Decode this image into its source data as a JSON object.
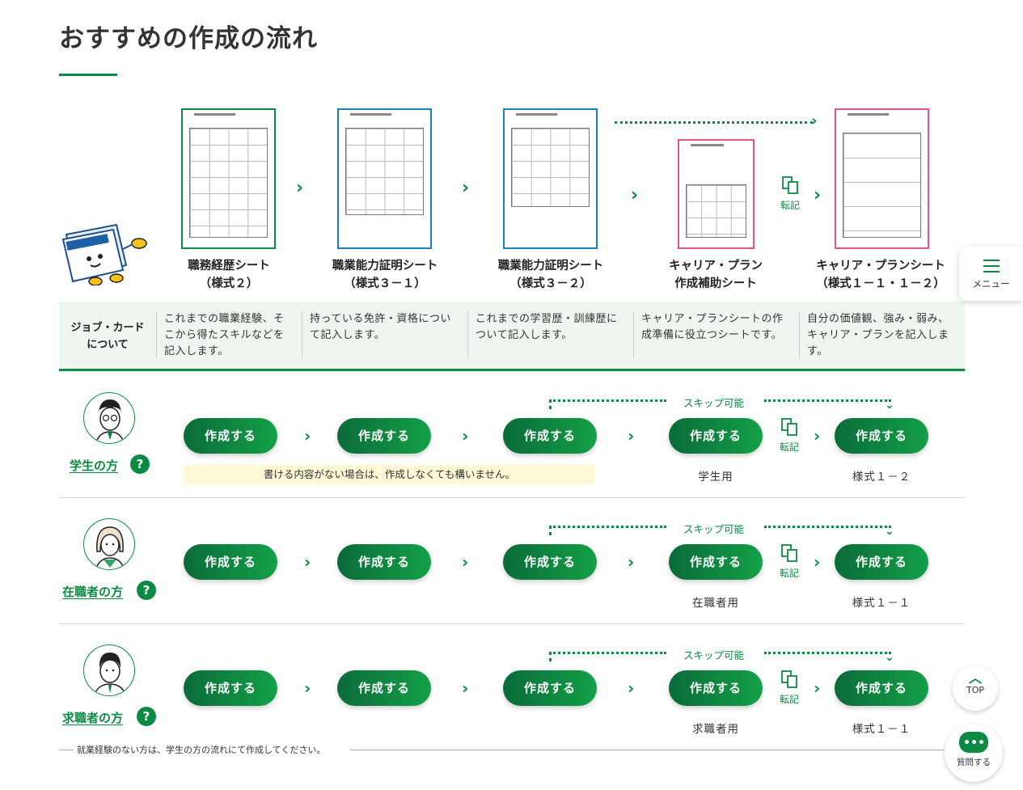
{
  "title": "おすすめの作成の流れ",
  "sheets": [
    {
      "label1": "職務経歴シート",
      "label2": "（様式２）"
    },
    {
      "label1": "職業能力証明シート",
      "label2": "（様式３－１）"
    },
    {
      "label1": "職業能力証明シート",
      "label2": "（様式３－２）"
    },
    {
      "label1": "キャリア・プラン",
      "label2": "作成補助シート"
    },
    {
      "label1": "キャリア・プランシート",
      "label2": "（様式１－１・１－２）"
    }
  ],
  "transfer_label": "転記",
  "mascot_text": "ジョブ・カード",
  "descriptions": {
    "label_line1": "ジョブ・カード",
    "label_line2": "について",
    "cells": [
      "これまでの職業経験、そこから得たスキルなどを記入します。",
      "持っている免許・資格について記入します。",
      "これまでの学習歴・訓練歴について記入します。",
      "キャリア・プランシートの作成準備に役立つシートです。",
      "自分の価値観、強み・弱み、キャリア・プランを記入します。"
    ]
  },
  "create_label": "作成する",
  "skip_label": "スキップ可能",
  "question_mark": "?",
  "personas": [
    {
      "name": "学生の方",
      "sub4": "学生用",
      "sub5": "様式１－２",
      "note": "書ける内容がない場合は、作成しなくても構いません。"
    },
    {
      "name": "在職者の方",
      "sub4": "在職者用",
      "sub5": "様式１－１"
    },
    {
      "name": "求職者の方",
      "sub4": "求職者用",
      "sub5": "様式１－１"
    }
  ],
  "footnote": "就業経験のない方は、学生の方の流れにて作成してください。",
  "menu_label": "メニュー",
  "top_label": "TOP",
  "ask_label": "質問する",
  "colors": {
    "accent": "#0b8a43",
    "blue": "#1f7fb8",
    "pink": "#e0558a",
    "band": "#eef6ef",
    "note": "#fdf8d6"
  }
}
